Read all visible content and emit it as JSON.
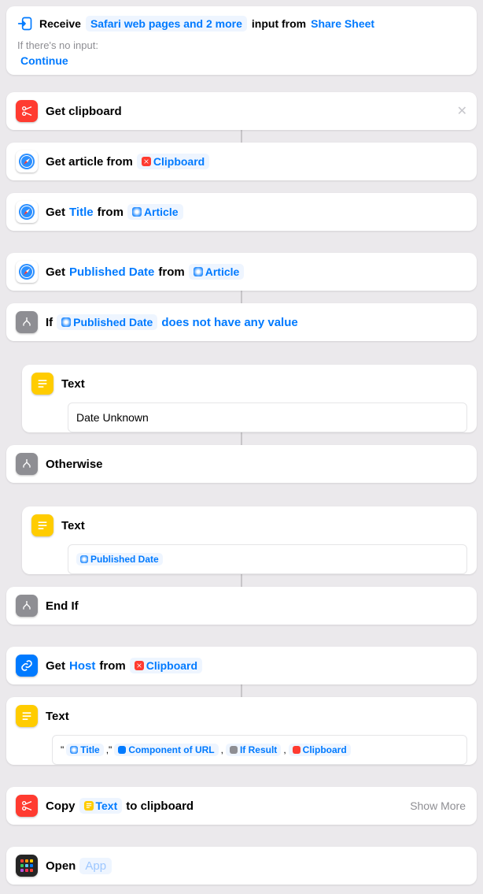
{
  "receive": {
    "label": "Receive",
    "input_types": "Safari web pages and 2 more",
    "input_from_label": "input from",
    "share_sheet": "Share Sheet",
    "no_input_label": "If there's no input:",
    "continue": "Continue"
  },
  "actions": {
    "get_clipboard": "Get clipboard",
    "get_article_from": "Get article from",
    "clipboard_token": "Clipboard",
    "get": "Get",
    "title_token": "Title",
    "from": "from",
    "article_token": "Article",
    "published_date_token": "Published Date",
    "if": "If",
    "does_not_have_value": "does not have any value",
    "text_label": "Text",
    "date_unknown": "Date Unknown",
    "otherwise": "Otherwise",
    "end_if": "End If",
    "host_token": "Host",
    "component_url_token": "Component of URL",
    "if_result_token": "If Result",
    "copy": "Copy",
    "to_clipboard": "to clipboard",
    "show_more": "Show More",
    "open": "Open",
    "app": "App"
  }
}
